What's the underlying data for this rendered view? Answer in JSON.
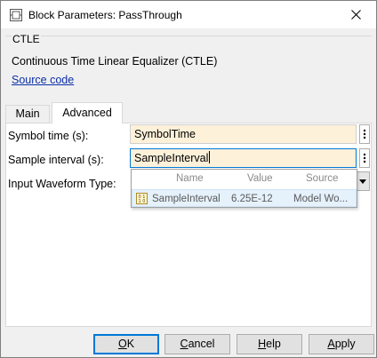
{
  "window": {
    "title": "Block Parameters: PassThrough"
  },
  "group": {
    "label": "CTLE",
    "description": "Continuous Time Linear Equalizer (CTLE)",
    "source_link": "Source code"
  },
  "tabs": [
    {
      "label": "Main",
      "active": false
    },
    {
      "label": "Advanced",
      "active": true
    }
  ],
  "params": {
    "symbol_time": {
      "label": "Symbol time (s):",
      "value": "SymbolTime"
    },
    "sample_interval": {
      "label": "Sample interval (s):",
      "value": "SampleInterval"
    },
    "input_waveform": {
      "label": "Input Waveform Type:"
    }
  },
  "autocomplete": {
    "headers": {
      "name": "Name",
      "value": "Value",
      "source": "Source"
    },
    "rows": [
      {
        "name": "SampleInterval",
        "value": "6.25E-12",
        "source": "Model Wo..."
      }
    ]
  },
  "buttons": {
    "ok": {
      "first": "O",
      "rest": "K"
    },
    "cancel": {
      "first": "C",
      "rest": "ancel"
    },
    "help": {
      "first": "H",
      "rest": "elp"
    },
    "apply": {
      "first": "A",
      "rest": "pply"
    }
  },
  "colors": {
    "accent": "#0078d7",
    "field_bg": "#fdf1da",
    "link": "#0b2fa8",
    "selected_row": "#e5f1fb"
  }
}
